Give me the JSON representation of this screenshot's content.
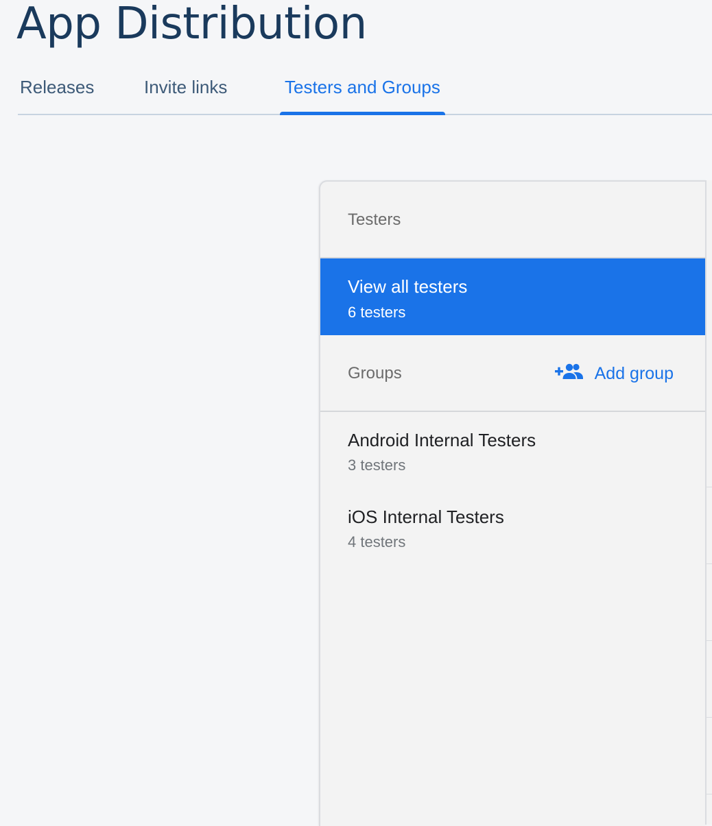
{
  "header": {
    "title": "App Distribution"
  },
  "tabs": [
    {
      "label": "Releases",
      "active": false
    },
    {
      "label": "Invite links",
      "active": false
    },
    {
      "label": "Testers and Groups",
      "active": true
    }
  ],
  "panel": {
    "testers_section_label": "Testers",
    "all_testers": {
      "title": "View all testers",
      "count": "6 testers",
      "selected": true
    },
    "groups_section_label": "Groups",
    "add_group_label": "Add group",
    "add_group_icon": "group-add-icon",
    "groups": [
      {
        "name": "Android Internal Testers",
        "count": "3 testers"
      },
      {
        "name": "iOS Internal Testers",
        "count": "4 testers"
      }
    ]
  },
  "colors": {
    "accent": "#1a73e8",
    "title": "#1a3a5c",
    "background": "#f5f6f8",
    "panel": "#f3f3f3"
  }
}
